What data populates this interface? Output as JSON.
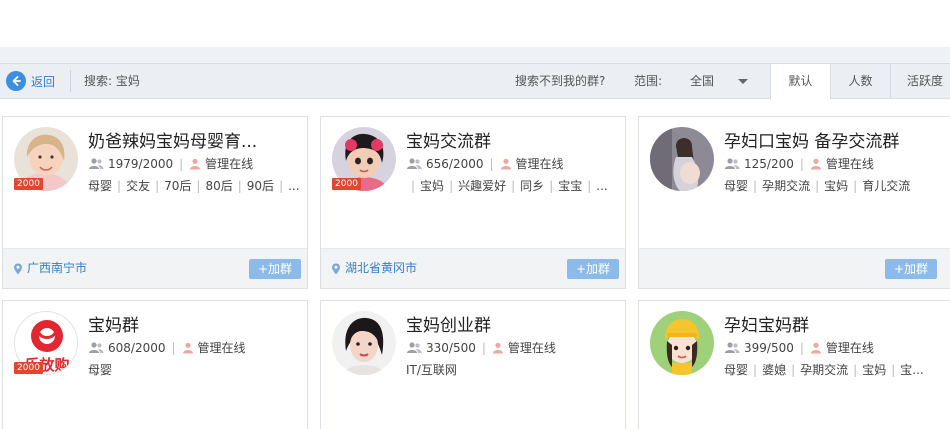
{
  "toolbar": {
    "back_label": "返回",
    "search_text": "搜索: 宝妈",
    "not_found_text": "搜索不到我的群?",
    "range_label": "范围:",
    "range_value": "全国",
    "sort_tabs": [
      "默认",
      "人数",
      "活跃度"
    ]
  },
  "colors": {
    "accent": "#3b8ee0",
    "badge": "#e5452f",
    "join_button": "#8cbbe9"
  },
  "groups": [
    {
      "name": "奶爸辣妈宝妈母婴育...",
      "members": "1979/2000",
      "admin_status": "管理在线",
      "tags": [
        "母婴",
        "交友",
        "70后",
        "80后",
        "90后",
        "..."
      ],
      "badge": "2000",
      "location": "广西南宁市",
      "join_label": "+加群",
      "avatar_icon": "girl-photo"
    },
    {
      "name": "宝妈交流群",
      "members": "656/2000",
      "admin_status": "管理在线",
      "tags": [
        "",
        "宝妈",
        "兴趣爱好",
        "同乡",
        "宝宝",
        "..."
      ],
      "badge": "2000",
      "location": "湖北省黄冈市",
      "join_label": "+加群",
      "avatar_icon": "child-photo"
    },
    {
      "name": "孕妇口宝妈 备孕交流群",
      "members": "125/200",
      "admin_status": "管理在线",
      "tags": [
        "母婴",
        "孕期交流",
        "宝妈",
        "育儿交流"
      ],
      "badge": "",
      "location": "",
      "join_label": "+加群",
      "avatar_icon": "pregnant-woman-photo"
    },
    {
      "name": "宝妈群",
      "members": "608/2000",
      "admin_status": "管理在线",
      "tags": [
        "母婴"
      ],
      "badge": "2000",
      "location": "",
      "join_label": "",
      "avatar_icon": "shop-logo",
      "logo_text": "乐放购"
    },
    {
      "name": "宝妈创业群",
      "members": "330/500",
      "admin_status": "管理在线",
      "tags": [
        "IT/互联网"
      ],
      "badge": "",
      "location": "",
      "join_label": "",
      "avatar_icon": "woman-portrait"
    },
    {
      "name": "孕妇宝妈群",
      "members": "399/500",
      "admin_status": "管理在线",
      "tags": [
        "母婴",
        "婆媳",
        "孕期交流",
        "宝妈",
        "宝..."
      ],
      "badge": "",
      "location": "",
      "join_label": "",
      "avatar_icon": "cartoon-girl"
    }
  ]
}
